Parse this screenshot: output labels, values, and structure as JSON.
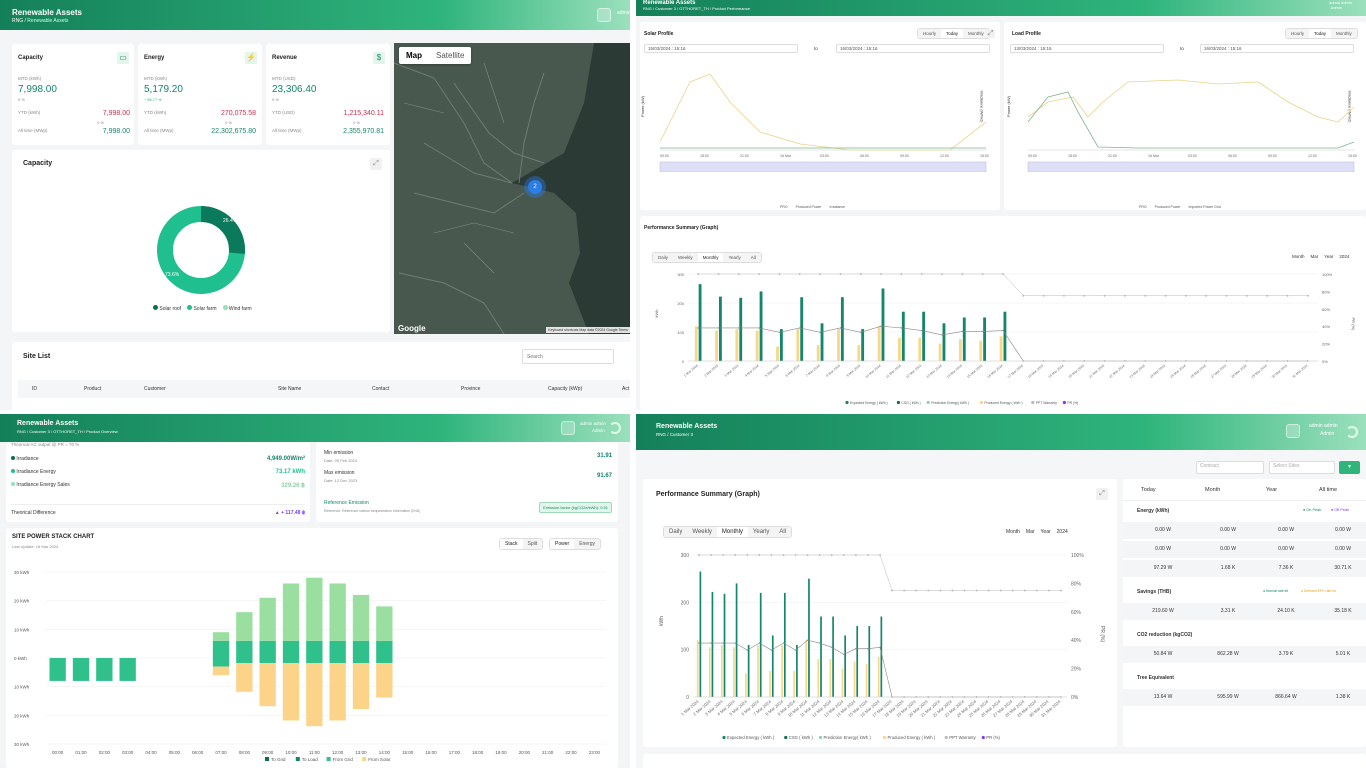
{
  "q1": {
    "header": {
      "title": "Renewable Assets",
      "crumb_root": "RNG",
      "crumb_sep": "/",
      "crumb_page": "Renewable Assets",
      "user": "admin"
    },
    "capacity": {
      "title": "Capacity",
      "mtd_label": "MTD (kWh)",
      "mtd": "7,998.00",
      "mtd_pct": "0 %",
      "ytd_label": "YTD (kWh)",
      "ytd": "7,998.00",
      "ytd_pct": "0 %",
      "all_label": "All time (MWp)",
      "all": "7,998.00"
    },
    "energy": {
      "title": "Energy",
      "mtd_label": "MTD (kWh)",
      "mtd": "5,179.20",
      "mtd_pct": "98.77 %",
      "ytd_label": "YTD (kWh)",
      "ytd": "270,075.58",
      "ytd_pct": "0 %",
      "all_label": "All time (MWp)",
      "all": "22,302,675.80"
    },
    "revenue": {
      "title": "Revenue",
      "mtd_label": "MTD (USD)",
      "mtd": "23,306.40",
      "mtd_pct": "0 %",
      "ytd_label": "YTD (USD)",
      "ytd": "1,215,340.11",
      "ytd_pct": "0 %",
      "all_label": "All time (MWp)",
      "all": "2,355,970.81"
    },
    "donut": {
      "title": "Capacity",
      "slices": [
        {
          "label": "Solar roof",
          "value": 0,
          "color": "#0e6e53"
        },
        {
          "label": "Solar farm",
          "value": 73.6,
          "color": "#1fbf8f"
        },
        {
          "label": "Wind farm",
          "value": 26.4,
          "color": "#0b7a5c"
        }
      ],
      "lbl_a": "26.4%",
      "lbl_b": "73.6%",
      "legend": [
        "Solar roof",
        "Solar farm",
        "Wind farm"
      ]
    },
    "map": {
      "tab_map": "Map",
      "tab_sat": "Satellite",
      "google": "Google",
      "attribution": "Keyboard shortcuts  Map data ©2024 Google  Terms",
      "marker": "2"
    },
    "site_list": {
      "title": "Site List",
      "search_placeholder": "Search",
      "columns": [
        "ID",
        "Product",
        "Customer",
        "Site Name",
        "Contact",
        "Province",
        "Capacity (kWp)",
        "Act"
      ]
    }
  },
  "q2": {
    "header": {
      "title": "Renewable Assets",
      "crumb": "RNG / Customer 3 / OTTHORET_TH / Product Performance",
      "user": "admin admin",
      "role": "Admin"
    },
    "solar": {
      "title": "Solar Profile",
      "tabs": [
        "Hourly",
        "Today",
        "Monthly"
      ],
      "from": "15/03/2024 : 15:16",
      "to_label": "to",
      "to": "16/03/2024 : 15:16",
      "ylabel": "Power (kW)",
      "ylabel_r": "Irradiance (W/m2)",
      "xticks": [
        "09:00",
        "18:00",
        "21:00",
        "16 Mar",
        "03:00",
        "06:00",
        "09:00",
        "12:00",
        "15:00"
      ],
      "legend": [
        "PRO",
        "Produced Power",
        "Irradiance"
      ]
    },
    "load": {
      "title": "Load Profile",
      "tabs": [
        "Hourly",
        "Today",
        "Monthly"
      ],
      "from": "13/03/2024 : 15:16",
      "to_label": "to",
      "to": "16/03/2024 : 15:16",
      "ylabel": "Power (kW)",
      "ylabel_r": "Irradiance (W/m2)",
      "xticks": [
        "09:00",
        "18:00",
        "21:00",
        "16 Mar",
        "03:00",
        "06:00",
        "09:00",
        "12:00",
        "15:00"
      ],
      "legend": [
        "PRO",
        "Produced Power",
        "Imported Power Grid"
      ]
    },
    "perf": {
      "title": "Performance Summary (Graph)",
      "tabs": [
        "Daily",
        "Weekly",
        "Monthly",
        "Yearly",
        "All"
      ],
      "month_label": "Month",
      "month_val": "Mar",
      "year_label": "Year",
      "year_val": "2024",
      "ylabel": "kWh",
      "ylabel_r": "PR (%)"
    }
  },
  "q3": {
    "header": {
      "title": "Renewable Assets",
      "crumb": "RNG / Customer 3 / OTTHORET_TH / Product Overview",
      "user": "admin admin",
      "role": "Admin"
    },
    "irr": {
      "note": "Theorical AC output  @ PR = 70 %",
      "rows": [
        {
          "label": "Irradiance",
          "value": "4,949.00W/m²"
        },
        {
          "label": "Irradiance Energy",
          "value": "73.17 kWh"
        },
        {
          "label": "Irradiance Energy Sales",
          "value": "329.26 ฿"
        }
      ],
      "diff_label": "Theorical Difference",
      "diff_value": "▲ + 117.48 ฿"
    },
    "emis": {
      "min_label": "Min emission",
      "min_date": "Date: 05 Feb 2024",
      "min_val": "31.91",
      "max_label": "Max emission",
      "max_date": "Date: 12 Dec 2023",
      "max_val": "91.67",
      "ref_label": "Reference Emission",
      "ref_sub": "Reference: Reference carbon sequestration information (EnD)",
      "factor": "Emission factor (kgCO2e/kWh): 0.51"
    },
    "stack": {
      "title": "SITE POWER STACK CHART",
      "updated": "Last Update: 16 Mar 2024",
      "tabs_a": [
        "Stack",
        "Split"
      ],
      "tabs_b": [
        "Power",
        "Energy"
      ],
      "yticks": [
        "30 kWh",
        "20 kWh",
        "10 kWh",
        "0 kWh",
        "10 kWh",
        "20 kWh",
        "30 kWh"
      ],
      "legend": [
        "To Grid",
        "To Load",
        "From Grid",
        "From Solar"
      ]
    }
  },
  "q4": {
    "header": {
      "title": "Renewable Assets",
      "crumb": "RNG / Customer 3",
      "user": "admin admin",
      "role": "Admin"
    },
    "filters": {
      "contract": "Contract",
      "sites": "Select Sites"
    },
    "perf": {
      "title": "Performance Summary (Graph)",
      "tabs": [
        "Daily",
        "Weekly",
        "Monthly",
        "Yearly",
        "All"
      ],
      "month_label": "Month",
      "month_val": "Mar",
      "year_label": "Year",
      "year_val": "2024",
      "ylabel": "kWh",
      "ylabel_r": "PR (%)"
    },
    "summary": {
      "cols": [
        "Today",
        "Month",
        "Year",
        "All time"
      ],
      "energy": {
        "title": "Energy (kWh)",
        "on": "On Peak",
        "off": "Off Peak",
        "rows": [
          [
            "0.00 W",
            "0.00 W",
            "0.00 W",
            "0.00 W"
          ],
          [
            "0.00 W",
            "0.00 W",
            "0.00 W",
            "0.00 W"
          ],
          [
            "97.29 W",
            "1.68 K",
            "7.36 K",
            "30.71 K"
          ]
        ]
      },
      "savings": {
        "title": "Savings (THB)",
        "n": "Normal rate kit",
        "d": "Demand EPK rate kit",
        "rows": [
          [
            "219.60 W",
            "3.31 K",
            "24.10 K",
            "35.18 K"
          ]
        ]
      },
      "co2": {
        "title": "CO2 reduction (kgCO2)",
        "rows": [
          [
            "50.84 W",
            "862.28 W",
            "3.79 K",
            "5.01 K"
          ]
        ]
      },
      "tree": {
        "title": "Tree Equivalent",
        "rows": [
          [
            "13.64 W",
            "595.99 W",
            "866.64 W",
            "1.38 K"
          ]
        ]
      }
    }
  },
  "chart_data": [
    {
      "type": "line",
      "title": "Solar Profile",
      "xlabel": "",
      "ylabel": "Power (kW)",
      "x": [
        "09:00",
        "18:00",
        "21:00",
        "16 Mar",
        "03:00",
        "06:00",
        "09:00",
        "12:00",
        "15:00"
      ],
      "series": [
        {
          "name": "Irradiance",
          "values": [
            40,
            60,
            20,
            5,
            0,
            0,
            0,
            0,
            20
          ]
        }
      ]
    },
    {
      "type": "line",
      "title": "Load Profile",
      "xlabel": "",
      "ylabel": "Power (kW)",
      "x": [
        "09:00",
        "18:00",
        "21:00",
        "16 Mar",
        "03:00",
        "06:00",
        "09:00",
        "12:00",
        "15:00"
      ],
      "series": [
        {
          "name": "Imported Power Grid",
          "values": [
            10,
            14,
            12,
            18,
            18,
            17,
            16,
            14,
            8
          ]
        }
      ]
    },
    {
      "type": "bar",
      "title": "Performance Summary (Graph)",
      "xlabel": "",
      "ylabel": "kWh",
      "ylim": [
        0,
        300
      ],
      "y2lim": [
        0,
        100
      ],
      "categories": [
        "1 Mar 2024",
        "2 Mar 2024",
        "3 Mar 2024",
        "4 Mar 2024",
        "5 Mar 2024",
        "6 Mar 2024",
        "7 Mar 2024",
        "8 Mar 2024",
        "9 Mar 2024",
        "10 Mar 2024",
        "11 Mar 2024",
        "12 Mar 2024",
        "13 Mar 2024",
        "14 Mar 2024",
        "15 Mar 2024",
        "16 Mar 2024",
        "17 Mar 2024",
        "18 Mar 2024",
        "19 Mar 2024",
        "20 Mar 2024",
        "21 Mar 2024",
        "22 Mar 2024",
        "23 Mar 2024",
        "24 Mar 2024",
        "25 Mar 2024",
        "26 Mar 2024",
        "27 Mar 2024",
        "28 Mar 2024",
        "29 Mar 2024",
        "30 Mar 2024",
        "31 Mar 2024"
      ],
      "series": [
        {
          "name": "CSG ( kWh )",
          "values": [
            265,
            222,
            218,
            240,
            110,
            220,
            130,
            220,
            110,
            250,
            170,
            170,
            130,
            150,
            150,
            170,
            0,
            0,
            0,
            0,
            0,
            0,
            0,
            0,
            0,
            0,
            0,
            0,
            0,
            0,
            0
          ]
        },
        {
          "name": "Produced Energy ( kWh )",
          "values": [
            120,
            105,
            110,
            105,
            50,
            110,
            55,
            110,
            55,
            120,
            80,
            80,
            60,
            75,
            70,
            85,
            0,
            0,
            0,
            0,
            0,
            0,
            0,
            0,
            0,
            0,
            0,
            0,
            0,
            0,
            0
          ]
        },
        {
          "name": "PR (%)",
          "values": [
            38,
            38,
            38,
            38,
            33,
            38,
            33,
            38,
            33,
            40,
            38,
            35,
            30,
            34,
            34,
            35,
            0,
            0,
            0,
            0,
            0,
            0,
            0,
            0,
            0,
            0,
            0,
            0,
            0,
            0,
            0
          ]
        },
        {
          "name": "PPT Warranty",
          "values": [
            100,
            100,
            100,
            100,
            100,
            100,
            100,
            100,
            100,
            100,
            100,
            100,
            100,
            100,
            100,
            100,
            75,
            75,
            75,
            75,
            75,
            75,
            75,
            75,
            75,
            75,
            75,
            75,
            75,
            75,
            75
          ]
        }
      ],
      "legend": [
        "Expected Energy ( kWh )",
        "CSG ( kWh )",
        "Prediction Energy( kWh )",
        "Produced Energy ( kWh )",
        "PPT Warranty",
        "PR (%)"
      ]
    },
    {
      "type": "bar",
      "title": "SITE POWER STACK CHART",
      "xlabel": "",
      "ylabel": "",
      "categories": [
        "00:00",
        "01:00",
        "02:00",
        "03:00",
        "04:00",
        "05:00",
        "06:00",
        "07:00",
        "08:00",
        "09:00",
        "10:00",
        "11:00",
        "12:00",
        "13:00",
        "14:00",
        "15:00",
        "16:00",
        "17:00",
        "18:00",
        "19:00",
        "20:00",
        "21:00",
        "22:00",
        "23:00"
      ],
      "series": [
        {
          "name": "To Grid",
          "values": [
            0,
            0,
            0,
            0,
            0,
            0,
            0,
            0,
            0,
            0,
            0,
            0,
            0,
            0,
            0,
            0,
            0,
            0,
            0,
            0,
            0,
            0,
            0,
            0
          ]
        },
        {
          "name": "To Load",
          "values": [
            -8,
            -8,
            -8,
            -8,
            0,
            0,
            0,
            -10,
            -6,
            -6,
            -6,
            -6,
            -6,
            -6,
            -6,
            0,
            0,
            0,
            0,
            0,
            0,
            0,
            0,
            0
          ]
        },
        {
          "name": "From Grid",
          "values": [
            0,
            0,
            0,
            0,
            0,
            0,
            0,
            6,
            6,
            6,
            6,
            6,
            6,
            6,
            6,
            0,
            0,
            0,
            0,
            0,
            0,
            0,
            0,
            0
          ]
        },
        {
          "name": "From Solar",
          "values": [
            0,
            0,
            0,
            0,
            0,
            0,
            0,
            3,
            10,
            15,
            20,
            22,
            20,
            16,
            12,
            0,
            0,
            0,
            0,
            0,
            0,
            0,
            0,
            0
          ]
        }
      ],
      "legend": [
        "To Grid",
        "To Load",
        "From Grid",
        "From Solar"
      ]
    }
  ]
}
